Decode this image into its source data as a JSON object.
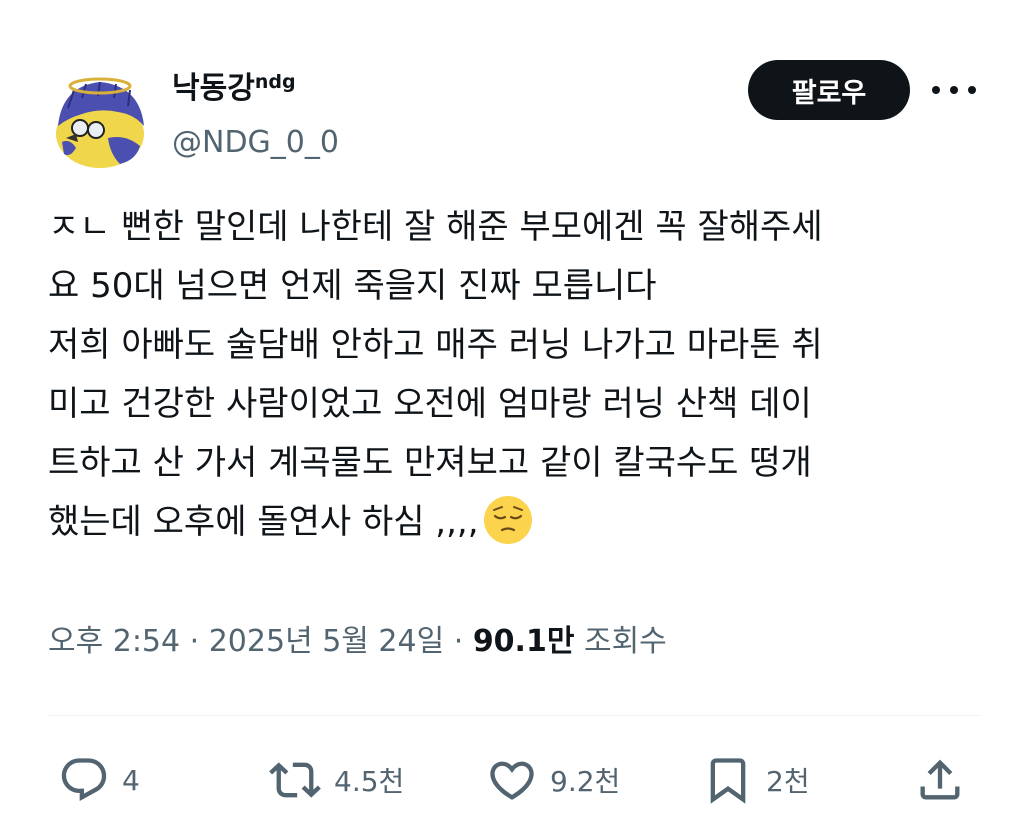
{
  "author": {
    "display_name": "낙동강",
    "display_name_sup": "ndg",
    "handle": "@NDG_0_0"
  },
  "header": {
    "follow_label": "팔로우",
    "more_icon": "more-horizontal-icon"
  },
  "tweet": {
    "lines": [
      "ㅈㄴ 뻔한 말인데 나한테 잘 해준 부모에겐 꼭 잘해주세",
      "요 50대 넘으면 언제 죽을지 진짜 모릅니다",
      "저희 아빠도 술담배 안하고 매주 러닝 나가고 마라톤 취",
      "미고 건강한 사람이었고 오전에 엄마랑 러닝 산책 데이",
      "트하고 산 가서 계곡물도 만져보고 같이 칼국수도 떵개",
      "했는데 오후에 돌연사 하심 ,,,,"
    ],
    "emoji": "pensive-face-emoji"
  },
  "meta": {
    "time": "오후 2:54",
    "sep1": " · ",
    "date": "2025년 5월 24일",
    "sep2": " · ",
    "views_count": "90.1만",
    "views_label": " 조회수"
  },
  "actions": {
    "reply": {
      "icon": "reply-icon",
      "count": "4"
    },
    "retweet": {
      "icon": "retweet-icon",
      "count": "4.5천"
    },
    "like": {
      "icon": "heart-icon",
      "count": "9.2천"
    },
    "bookmark": {
      "icon": "bookmark-icon",
      "count": "2천"
    },
    "share": {
      "icon": "share-icon"
    }
  },
  "colors": {
    "text_primary": "#0f1419",
    "text_secondary": "#536471",
    "follow_bg": "#0f1419",
    "divider": "#eff3f4",
    "avatar_blue": "#4a4fb0",
    "avatar_yellow": "#f0d64a"
  }
}
